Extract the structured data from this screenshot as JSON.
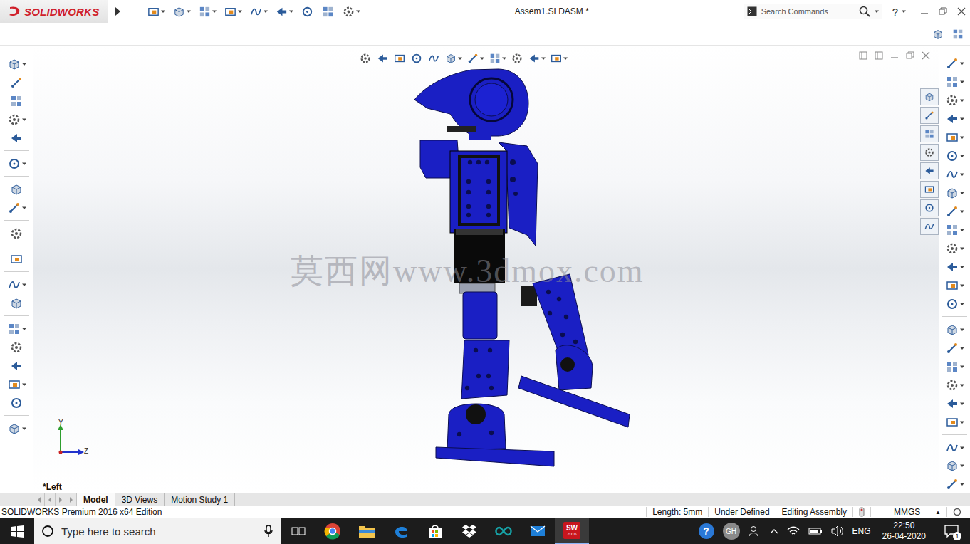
{
  "app": {
    "logo": "SOLIDWORKS"
  },
  "window": {
    "title": "Assem1.SLDASM *"
  },
  "search": {
    "placeholder": "Search Commands"
  },
  "help": "?",
  "view": {
    "orientation": "*Left",
    "axes": {
      "y": "Y",
      "z": "Z"
    }
  },
  "watermark": "莫西网www.3dmox.com",
  "tabs": [
    {
      "label": "Model",
      "selected": true
    },
    {
      "label": "3D Views",
      "selected": false
    },
    {
      "label": "Motion Study 1",
      "selected": false
    }
  ],
  "status_bar": {
    "edition": "SOLIDWORKS Premium 2016 x64 Edition",
    "length": "Length: 5mm",
    "definition": "Under Defined",
    "mode": "Editing Assembly",
    "units": "MMGS",
    "units_arrow": "▲"
  },
  "taskbar": {
    "search_placeholder": "Type here to search",
    "app_badge": {
      "top": "SW",
      "bottom": "2016"
    },
    "help": "?",
    "avatar": "GH",
    "language": "ENG",
    "time": "22:50",
    "date": "26-04-2020",
    "notifications": "1"
  }
}
